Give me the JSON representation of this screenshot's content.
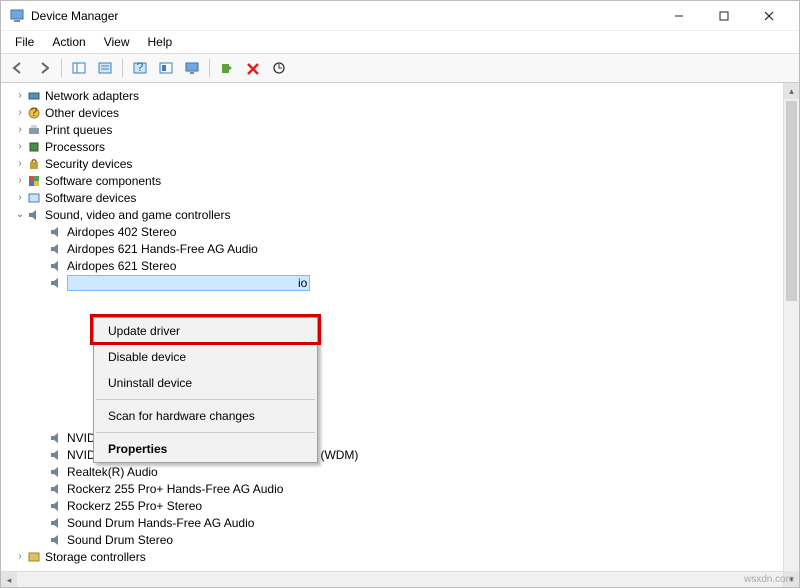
{
  "window": {
    "title": "Device Manager"
  },
  "menubar": [
    "File",
    "Action",
    "View",
    "Help"
  ],
  "tree": {
    "collapsed": [
      {
        "label": "Network adapters",
        "icon": "net"
      },
      {
        "label": "Other devices",
        "icon": "other"
      },
      {
        "label": "Print queues",
        "icon": "printer"
      },
      {
        "label": "Processors",
        "icon": "cpu"
      },
      {
        "label": "Security devices",
        "icon": "security"
      },
      {
        "label": "Software components",
        "icon": "softcomp"
      },
      {
        "label": "Software devices",
        "icon": "softdev"
      }
    ],
    "expanded": {
      "label": "Sound, video and game controllers",
      "icon": "sound",
      "children": [
        "Airdopes 402 Stereo",
        "Airdopes 621 Hands-Free AG Audio",
        "Airdopes 621 Stereo"
      ],
      "selected_suffix": "io",
      "children_after": [
        "NVIDIA High Definition Audio",
        "NVIDIA Virtual Audio Device (Wave Extensible) (WDM)",
        "Realtek(R) Audio",
        "Rockerz 255 Pro+ Hands-Free AG Audio",
        "Rockerz 255 Pro+ Stereo",
        "Sound Drum Hands-Free AG Audio",
        "Sound Drum Stereo"
      ]
    },
    "last": {
      "label": "Storage controllers",
      "icon": "storage"
    }
  },
  "context_menu": {
    "items": [
      {
        "label": "Update driver",
        "highlighted": true
      },
      {
        "label": "Disable device"
      },
      {
        "label": "Uninstall device"
      }
    ],
    "scan": "Scan for hardware changes",
    "properties": "Properties"
  },
  "watermark": "wsxdn.com"
}
